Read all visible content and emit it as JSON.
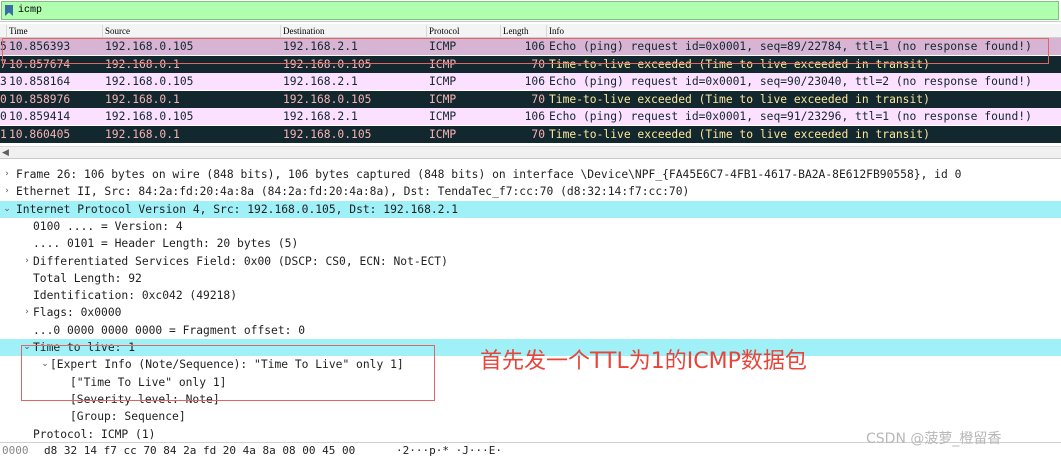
{
  "filter": {
    "value": "icmp"
  },
  "columns": [
    "Time",
    "Source",
    "Destination",
    "Protocol",
    "Length",
    "Info"
  ],
  "packets": [
    {
      "no": "5",
      "time": "10.856393",
      "src": "192.168.0.105",
      "dst": "192.168.2.1",
      "proto": "ICMP",
      "len": "106",
      "info": "Echo (ping) request  id=0x0001, seq=89/22784, ttl=1 (no response found!)",
      "kind": "selected"
    },
    {
      "no": "7",
      "time": "10.857674",
      "src": "192.168.0.1",
      "dst": "192.168.0.105",
      "proto": "ICMP",
      "len": "70",
      "info": "Time-to-live exceeded (Time to live exceeded in transit)",
      "kind": "ttl"
    },
    {
      "no": "3",
      "time": "10.858164",
      "src": "192.168.0.105",
      "dst": "192.168.2.1",
      "proto": "ICMP",
      "len": "106",
      "info": "Echo (ping) request  id=0x0001, seq=90/23040, ttl=2 (no response found!)",
      "kind": "echo"
    },
    {
      "no": "0",
      "time": "10.858976",
      "src": "192.168.0.1",
      "dst": "192.168.0.105",
      "proto": "ICMP",
      "len": "70",
      "info": "Time-to-live exceeded (Time to live exceeded in transit)",
      "kind": "ttl"
    },
    {
      "no": "0",
      "time": "10.859414",
      "src": "192.168.0.105",
      "dst": "192.168.2.1",
      "proto": "ICMP",
      "len": "106",
      "info": "Echo (ping) request  id=0x0001, seq=91/23296, ttl=1 (no response found!)",
      "kind": "echo"
    },
    {
      "no": "1",
      "time": "10.860405",
      "src": "192.168.0.1",
      "dst": "192.168.0.105",
      "proto": "ICMP",
      "len": "70",
      "info": "Time-to-live exceeded (Time to live exceeded in transit)",
      "kind": "ttl"
    }
  ],
  "tree": [
    {
      "text": "Frame 26: 106 bytes on wire (848 bits), 106 bytes captured (848 bits) on interface \\Device\\NPF_{FA45E6C7-4FB1-4617-BA2A-8E612FB90558}, id 0",
      "arrow": ">",
      "hl": false
    },
    {
      "text": "Ethernet II, Src: 84:2a:fd:20:4a:8a (84:2a:fd:20:4a:8a), Dst: TendaTec_f7:cc:70 (d8:32:14:f7:cc:70)",
      "arrow": ">",
      "hl": false
    },
    {
      "text": "Internet Protocol Version 4, Src: 192.168.0.105, Dst: 192.168.2.1",
      "arrow": "v",
      "hl": true
    },
    {
      "text": "0100 .... = Version: 4",
      "arrow": "",
      "hl": false
    },
    {
      "text": ".... 0101 = Header Length: 20 bytes (5)",
      "arrow": "",
      "hl": false
    },
    {
      "text": "Differentiated Services Field: 0x00 (DSCP: CS0, ECN: Not-ECT)",
      "arrow": ">",
      "hl": false
    },
    {
      "text": "Total Length: 92",
      "arrow": "",
      "hl": false
    },
    {
      "text": "Identification: 0xc042 (49218)",
      "arrow": "",
      "hl": false
    },
    {
      "text": "Flags: 0x0000",
      "arrow": ">",
      "hl": false
    },
    {
      "text": "...0 0000 0000 0000 = Fragment offset: 0",
      "arrow": "",
      "hl": false
    },
    {
      "text": "Time to live: 1",
      "arrow": "v",
      "hl": true
    },
    {
      "text": "[Expert Info (Note/Sequence): \"Time To Live\" only 1]",
      "arrow": "v",
      "hl": false
    },
    {
      "text": "[\"Time To Live\" only 1]",
      "arrow": "",
      "hl": false
    },
    {
      "text": "[Severity level: Note]",
      "arrow": "",
      "hl": false
    },
    {
      "text": "[Group: Sequence]",
      "arrow": "",
      "hl": false
    },
    {
      "text": "Protocol: ICMP (1)",
      "arrow": "",
      "hl": false
    }
  ],
  "annotation": "首先发一个TTL为1的ICMP数据包",
  "bytes": {
    "offset": "0000",
    "hex": "d8 32 14 f7 cc 70 84 2a  fd 20 4a 8a 08 00 45 00",
    "ascii": "·2···p·* ·J···E·"
  },
  "watermark": "CSDN @菠萝_橙留香",
  "colors": {
    "filter_ok": "#afffaf",
    "echo_row": "#fce0ff",
    "ttl_row": "#12272e",
    "tree_highlight": "#a0f0f8",
    "annotation": "#e8443a"
  }
}
